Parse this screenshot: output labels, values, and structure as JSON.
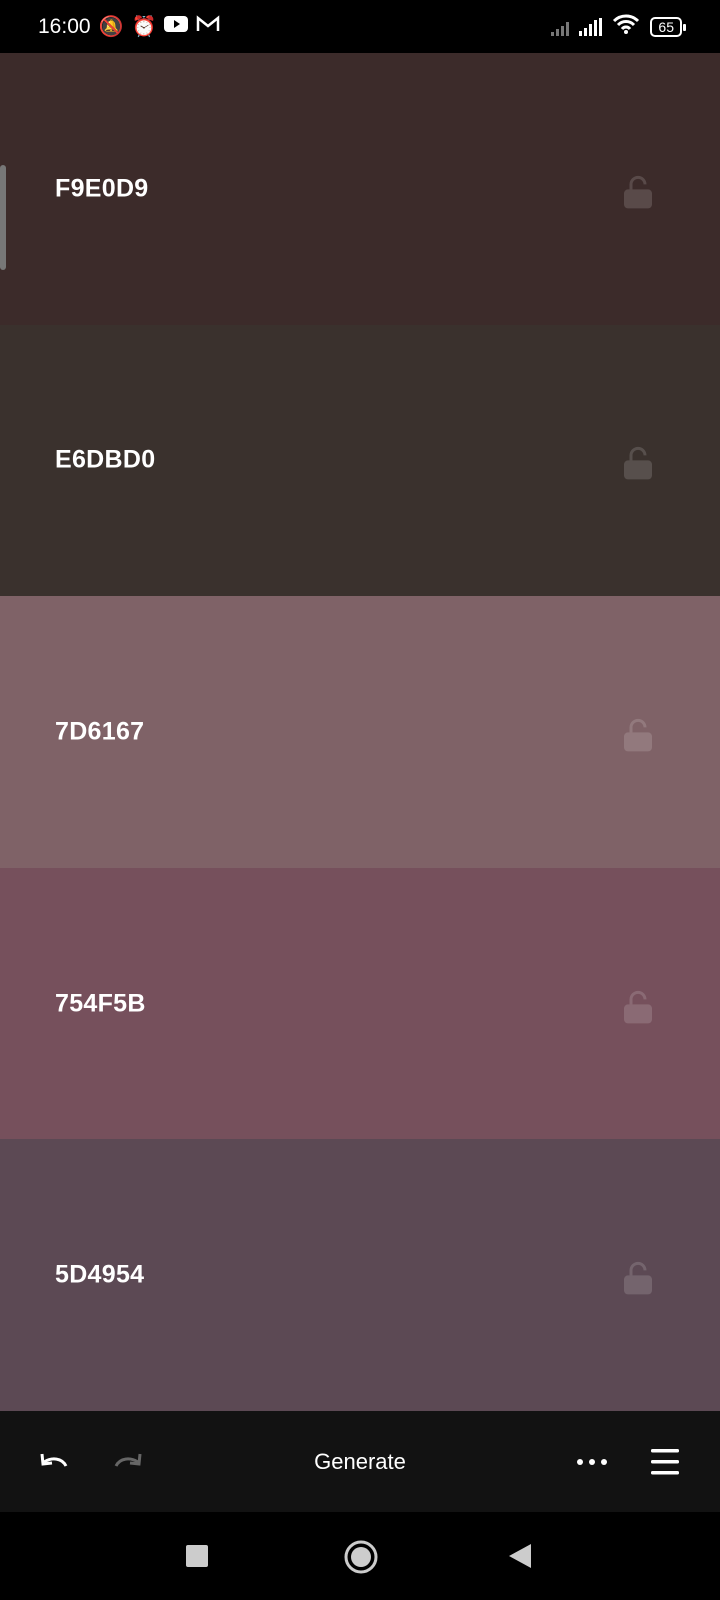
{
  "status_bar": {
    "time": "16:00",
    "battery": "65",
    "icons": [
      "vibrate-off-icon",
      "alarm-icon",
      "youtube-icon",
      "gmail-icon",
      "signal-no-sim-icon",
      "signal-icon",
      "wifi-icon",
      "battery-icon"
    ]
  },
  "swatches": [
    {
      "hex": "F9E0D9",
      "color": "#3c2b2a",
      "locked": false
    },
    {
      "hex": "E6DBD0",
      "color": "#3a312d",
      "locked": false
    },
    {
      "hex": "7D6167",
      "color": "#7f6267",
      "locked": false
    },
    {
      "hex": "754F5B",
      "color": "#76505c",
      "locked": false
    },
    {
      "hex": "5D4954",
      "color": "#5c4954",
      "locked": false
    }
  ],
  "toolbar": {
    "generate_label": "Generate"
  }
}
